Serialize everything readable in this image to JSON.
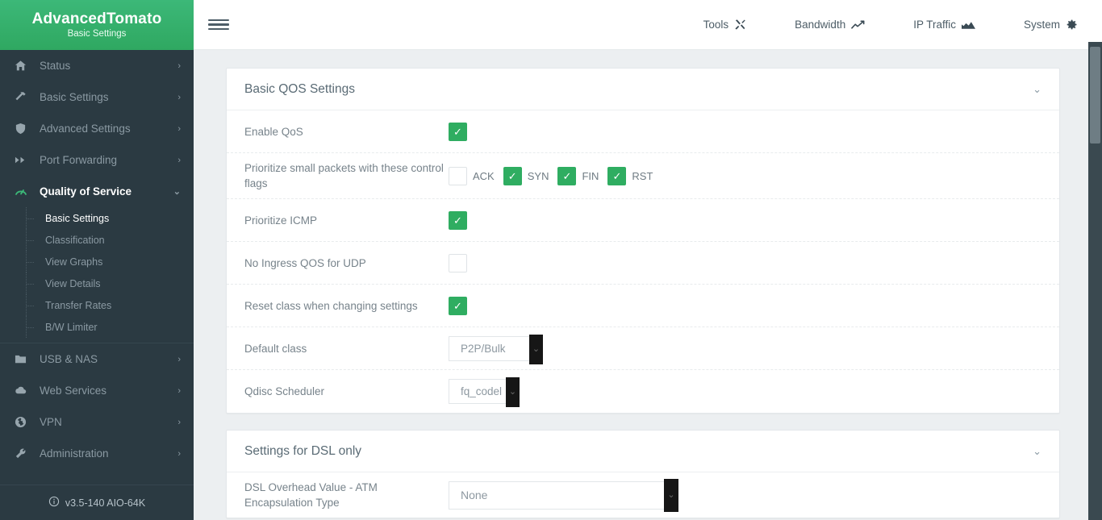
{
  "brand": {
    "title_part1": "Advanced",
    "title_part2": "Tomato",
    "subtitle": "Basic Settings"
  },
  "sidebar": {
    "items": [
      {
        "label": "Status",
        "icon": "home-icon",
        "chevron": "›",
        "active": false
      },
      {
        "label": "Basic Settings",
        "icon": "hammer-icon",
        "chevron": "›",
        "active": false
      },
      {
        "label": "Advanced Settings",
        "icon": "shield-icon",
        "chevron": "›",
        "active": false
      },
      {
        "label": "Port Forwarding",
        "icon": "forward-icon",
        "chevron": "›",
        "active": false
      },
      {
        "label": "Quality of Service",
        "icon": "speedometer-icon",
        "chevron": "⌄",
        "active": true
      },
      {
        "label": "USB & NAS",
        "icon": "folder-icon",
        "chevron": "›",
        "active": false
      },
      {
        "label": "Web Services",
        "icon": "cloud-icon",
        "chevron": "›",
        "active": false
      },
      {
        "label": "VPN",
        "icon": "globe-icon",
        "chevron": "›",
        "active": false
      },
      {
        "label": "Administration",
        "icon": "wrench-icon",
        "chevron": "›",
        "active": false
      }
    ],
    "qos_submenu": [
      {
        "label": "Basic Settings",
        "active": true
      },
      {
        "label": "Classification",
        "active": false
      },
      {
        "label": "View Graphs",
        "active": false
      },
      {
        "label": "View Details",
        "active": false
      },
      {
        "label": "Transfer Rates",
        "active": false
      },
      {
        "label": "B/W Limiter",
        "active": false
      }
    ],
    "footer": {
      "icon": "info-icon",
      "version": "v3.5-140 AIO-64K"
    }
  },
  "topbar": {
    "menu_toggle": "hamburger-icon",
    "nav": [
      {
        "label": "Tools",
        "icon": "tools-icon"
      },
      {
        "label": "Bandwidth",
        "icon": "line-chart-icon"
      },
      {
        "label": "IP Traffic",
        "icon": "area-chart-icon"
      },
      {
        "label": "System",
        "icon": "gear-icon"
      }
    ]
  },
  "panels": [
    {
      "title": "Basic QOS Settings",
      "chevron": "⌄",
      "rows": [
        {
          "label": "Enable QoS",
          "type": "checkbox",
          "checked": true
        },
        {
          "label": "Prioritize small packets with these control flags",
          "type": "flags",
          "flags": [
            {
              "name": "ACK",
              "checked": false
            },
            {
              "name": "SYN",
              "checked": true
            },
            {
              "name": "FIN",
              "checked": true
            },
            {
              "name": "RST",
              "checked": true
            }
          ]
        },
        {
          "label": "Prioritize ICMP",
          "type": "checkbox",
          "checked": true
        },
        {
          "label": "No Ingress QOS for UDP",
          "type": "checkbox",
          "checked": false
        },
        {
          "label": "Reset class when changing settings",
          "type": "checkbox",
          "checked": true
        },
        {
          "label": "Default class",
          "type": "select",
          "value": "P2P/Bulk",
          "width": "w-default"
        },
        {
          "label": "Qdisc Scheduler",
          "type": "select",
          "value": "fq_codel",
          "width": "w-qdisc"
        }
      ]
    },
    {
      "title": "Settings for DSL only",
      "chevron": "⌄",
      "rows": [
        {
          "label": "DSL Overhead Value - ATM Encapsulation Type",
          "type": "select",
          "value": "None",
          "width": "w-dsl"
        }
      ]
    }
  ],
  "colors": {
    "brand_green": "#33b06a",
    "checkbox_green": "#2fad61",
    "sidebar_bg": "#2b3a42",
    "page_bg": "#eceff1",
    "panel_bg": "#ffffff",
    "text_muted": "#77838b"
  }
}
